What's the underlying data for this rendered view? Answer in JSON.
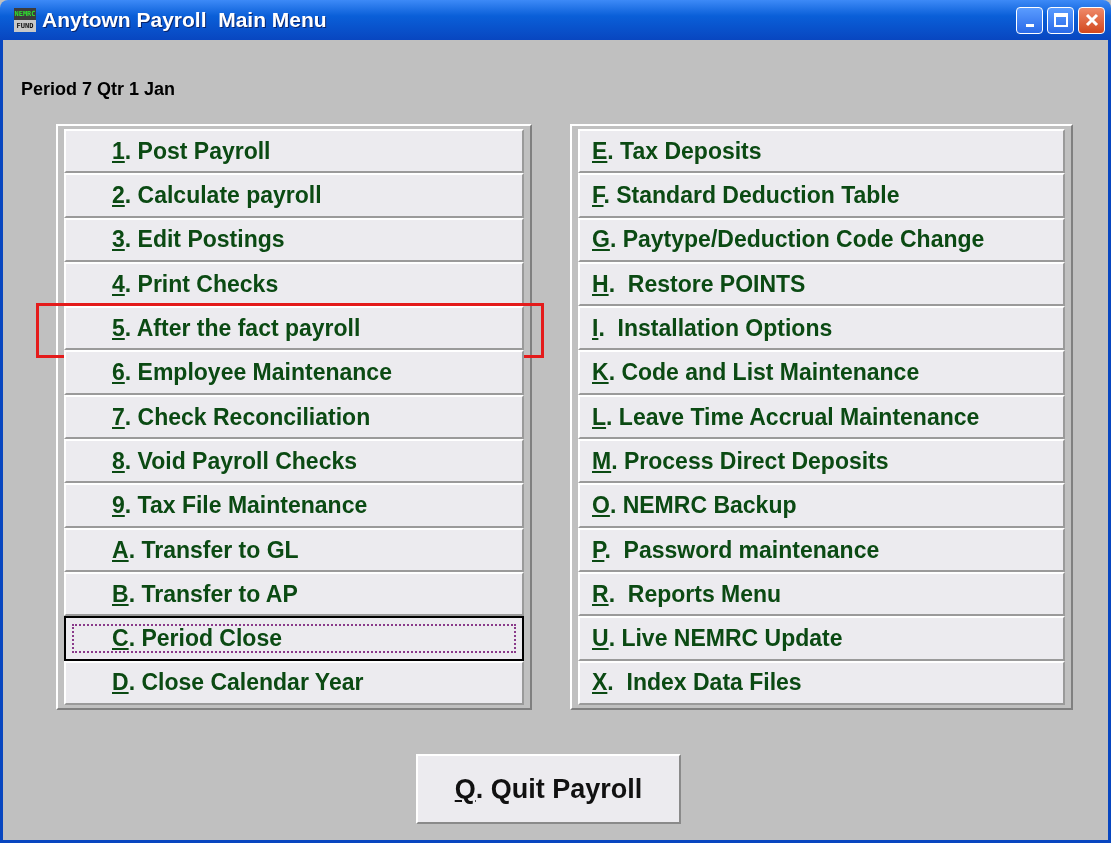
{
  "window": {
    "title": "Anytown Payroll  Main Menu",
    "logo_top": "NEMRC",
    "logo_bottom": "FUND"
  },
  "period": "Period 7 Qtr 1 Jan",
  "left_menu": [
    {
      "key": "1",
      "text": ". Post Payroll",
      "focused": false,
      "highlighted": false
    },
    {
      "key": "2",
      "text": ". Calculate payroll",
      "focused": false,
      "highlighted": false
    },
    {
      "key": "3",
      "text": ". Edit Postings",
      "focused": false,
      "highlighted": false
    },
    {
      "key": "4",
      "text": ". Print Checks",
      "focused": false,
      "highlighted": false
    },
    {
      "key": "5",
      "text": ". After the fact payroll",
      "focused": false,
      "highlighted": true
    },
    {
      "key": "6",
      "text": ". Employee Maintenance",
      "focused": false,
      "highlighted": false
    },
    {
      "key": "7",
      "text": ". Check Reconciliation",
      "focused": false,
      "highlighted": false
    },
    {
      "key": "8",
      "text": ". Void Payroll Checks",
      "focused": false,
      "highlighted": false
    },
    {
      "key": "9",
      "text": ". Tax File Maintenance",
      "focused": false,
      "highlighted": false
    },
    {
      "key": "A",
      "text": ". Transfer to GL",
      "focused": false,
      "highlighted": false
    },
    {
      "key": "B",
      "text": ". Transfer to AP",
      "focused": false,
      "highlighted": false
    },
    {
      "key": "C",
      "text": ". Period Close",
      "focused": true,
      "highlighted": false
    },
    {
      "key": "D",
      "text": ". Close Calendar Year",
      "focused": false,
      "highlighted": false
    }
  ],
  "right_menu": [
    {
      "key": "E",
      "text": ". Tax Deposits",
      "focused": false,
      "highlighted": false
    },
    {
      "key": "F",
      "text": ". Standard Deduction Table",
      "focused": false,
      "highlighted": false
    },
    {
      "key": "G",
      "text": ". Paytype/Deduction Code Change",
      "focused": false,
      "highlighted": false
    },
    {
      "key": "H",
      "text": ".  Restore POINTS",
      "focused": false,
      "highlighted": false
    },
    {
      "key": "I",
      "text": ".  Installation Options",
      "focused": false,
      "highlighted": false
    },
    {
      "key": "K",
      "text": ". Code and List Maintenance",
      "focused": false,
      "highlighted": false
    },
    {
      "key": "L",
      "text": ". Leave Time Accrual Maintenance",
      "focused": false,
      "highlighted": false
    },
    {
      "key": "M",
      "text": ". Process Direct Deposits",
      "focused": false,
      "highlighted": false
    },
    {
      "key": "O",
      "text": ". NEMRC Backup",
      "focused": false,
      "highlighted": false
    },
    {
      "key": "P",
      "text": ".  Password maintenance",
      "focused": false,
      "highlighted": false
    },
    {
      "key": "R",
      "text": ".  Reports Menu",
      "focused": false,
      "highlighted": false
    },
    {
      "key": "U",
      "text": ". Live NEMRC Update",
      "focused": false,
      "highlighted": false
    },
    {
      "key": "X",
      "text": ".  Index Data Files",
      "focused": false,
      "highlighted": false
    }
  ],
  "quit_button": {
    "key": "Q",
    "text": ". Quit Payroll"
  }
}
